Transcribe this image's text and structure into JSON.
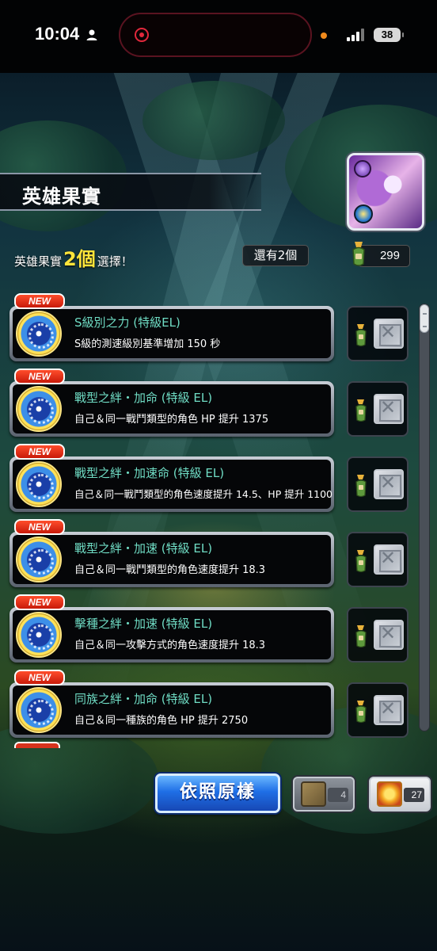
{
  "status_bar": {
    "time": "10:04",
    "battery": "38"
  },
  "header": {
    "title": "英雄果實",
    "subtitle_prefix": "英雄果實",
    "subtitle_count": "2個",
    "subtitle_suffix": "選擇！",
    "remaining": "還有2個",
    "currency_amount": "299"
  },
  "items": [
    {
      "tag": "NEW",
      "title": "S級別之力 (特級EL)",
      "desc": "S級的測速級別基準增加 150 秒"
    },
    {
      "tag": "NEW",
      "title": "戰型之絆・加命 (特級 EL)",
      "desc": "自己＆同一戰鬥類型的角色 HP 提升 1375"
    },
    {
      "tag": "NEW",
      "title": "戰型之絆・加速命 (特級 EL)",
      "desc": "自己＆同一戰鬥類型的角色速度提升 14.5、HP 提升 1100"
    },
    {
      "tag": "NEW",
      "title": "戰型之絆・加速 (特級 EL)",
      "desc": "自己＆同一戰鬥類型的角色速度提升 18.3"
    },
    {
      "tag": "NEW",
      "title": "擊種之絆・加速 (特級 EL)",
      "desc": "自己＆同一攻擊方式的角色速度提升 18.3"
    },
    {
      "tag": "NEW",
      "title": "同族之絆・加命 (特級 EL)",
      "desc": "自己＆同一種族的角色 HP 提升 2750"
    }
  ],
  "bottom": {
    "default_button": "依照原樣",
    "scroll_gray_count": "4",
    "scroll_gold_count": "27"
  },
  "colors": {
    "item_title": "#6fdcc4",
    "count_highlight": "#ffe53a",
    "new_tag": "#d7331d",
    "button_blue": "#1f6fe6"
  },
  "icons": {
    "orb": "fruit-orb-icon",
    "bottle": "fruit-bottle-icon",
    "checkbox": "empty-checkbox-icon"
  }
}
